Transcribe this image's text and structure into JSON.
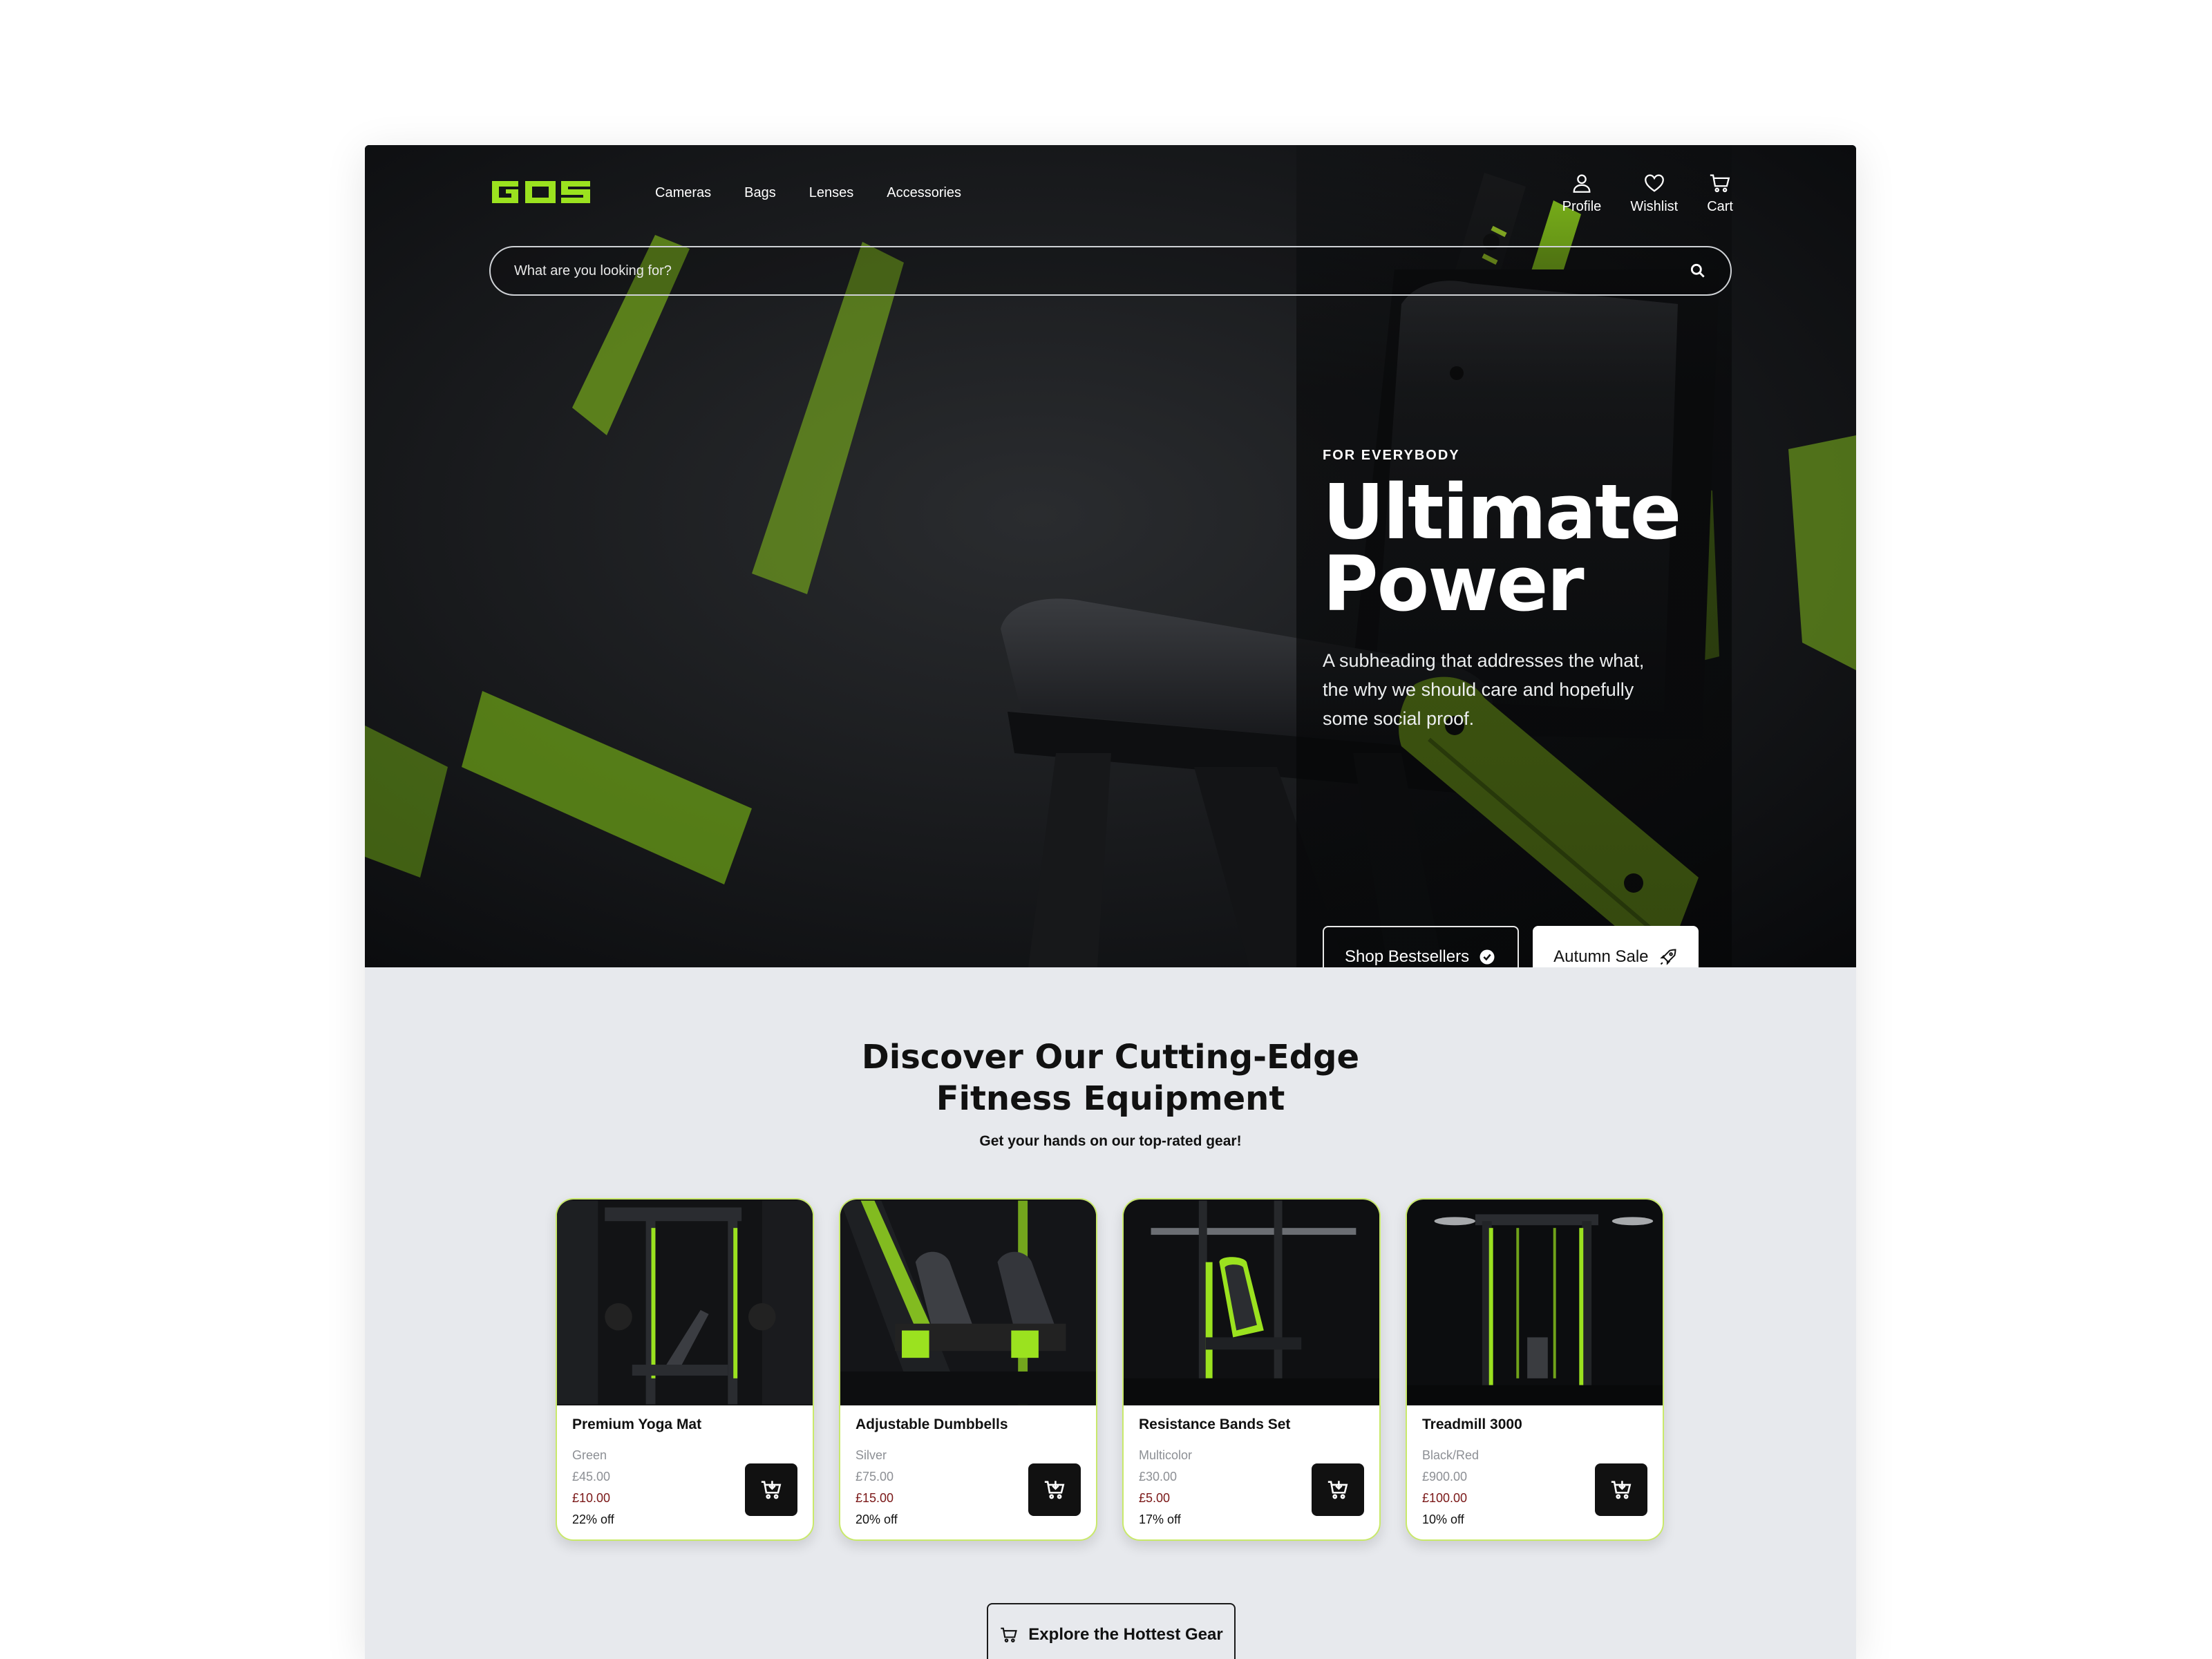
{
  "brand": {
    "logo_text": "GOS",
    "accent_color": "#9be21f"
  },
  "nav": {
    "links": [
      "Cameras",
      "Bags",
      "Lenses",
      "Accessories"
    ],
    "actions": [
      {
        "label": "Profile",
        "icon": "user-icon"
      },
      {
        "label": "Wishlist",
        "icon": "heart-icon"
      },
      {
        "label": "Cart",
        "icon": "cart-icon"
      }
    ]
  },
  "search": {
    "placeholder": "What are you looking for?",
    "value": ""
  },
  "hero": {
    "eyebrow": "FOR EVERYBODY",
    "title_line1": "Ultimate",
    "title_line2": "Power",
    "subheading": "A subheading that addresses the what, the why we should care and hopefully some social proof.",
    "primary_cta": "Shop Bestsellers",
    "secondary_cta": "Autumn Sale"
  },
  "section": {
    "title_line1": "Discover Our Cutting-Edge",
    "title_line2": "Fitness Equipment",
    "subtitle": "Get your hands on our top-rated gear!"
  },
  "products": [
    {
      "name": "Premium Yoga Mat",
      "variant": "Green",
      "old_price": "£45.00",
      "price": "£10.00",
      "discount": "22% off"
    },
    {
      "name": "Adjustable Dumbbells",
      "variant": "Silver",
      "old_price": "£75.00",
      "price": "£15.00",
      "discount": "20% off"
    },
    {
      "name": "Resistance Bands Set",
      "variant": "Multicolor",
      "old_price": "£30.00",
      "price": "£5.00",
      "discount": "17% off"
    },
    {
      "name": "Treadmill 3000",
      "variant": "Black/Red",
      "old_price": "£900.00",
      "price": "£100.00",
      "discount": "10% off"
    }
  ],
  "explore_cta": "Explore the Hottest Gear"
}
